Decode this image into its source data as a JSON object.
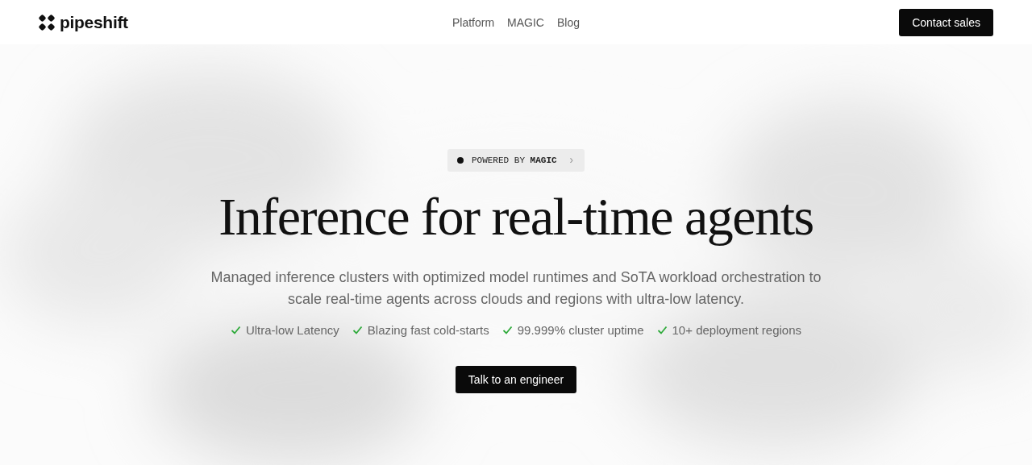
{
  "header": {
    "logo": "pipeshift",
    "nav": [
      "Platform",
      "MAGIC",
      "Blog"
    ],
    "cta": "Contact sales"
  },
  "hero": {
    "badge": {
      "text": "POWERED BY **MAGIC**",
      "chevron": "›"
    },
    "title": "Inference for real-time agents",
    "subtitle": "Managed inference clusters with optimized model runtimes and SoTA workload orchestration to scale real-time agents across clouds and regions with ultra-low latency.",
    "features": [
      "Ultra-low Latency",
      "Blazing fast cold-starts",
      "99.999% cluster uptime",
      "10+ deployment regions"
    ],
    "button": "Talk to an engineer"
  }
}
